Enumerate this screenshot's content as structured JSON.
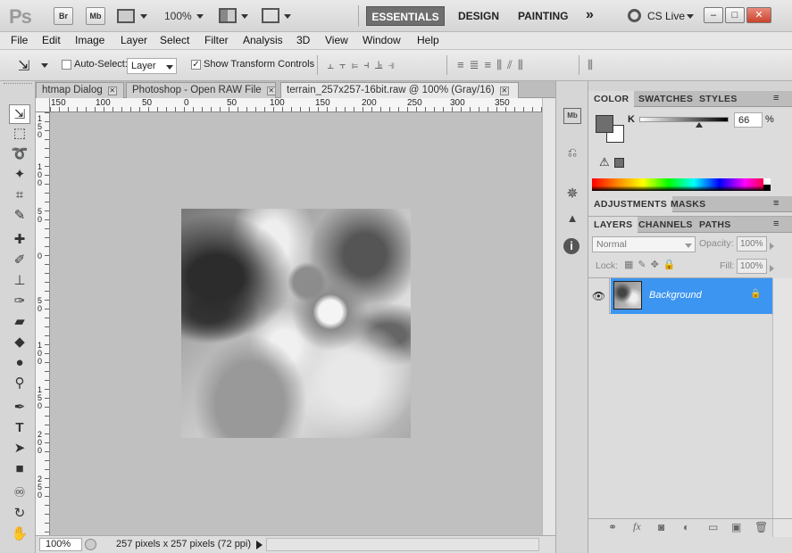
{
  "app": {
    "logo": "Ps",
    "bridge_label": "Br",
    "minibridge_label": "Mb",
    "zoom": "100%",
    "workspaces": [
      "ESSENTIALS",
      "DESIGN",
      "PAINTING"
    ],
    "more": "»",
    "cslive": "CS Live"
  },
  "window_controls": {
    "minimize": "–",
    "restore": "□",
    "close": "✕"
  },
  "menu": [
    "File",
    "Edit",
    "Image",
    "Layer",
    "Select",
    "Filter",
    "Analysis",
    "3D",
    "View",
    "Window",
    "Help"
  ],
  "options": {
    "auto_select_label": "Auto-Select:",
    "auto_select_value": "Layer",
    "show_transform_label": "Show Transform Controls",
    "show_transform_checked": "✓"
  },
  "tabs": [
    {
      "label": "htmap Dialog"
    },
    {
      "label": "Photoshop - Open RAW File"
    },
    {
      "label": "terrain_257x257-16bit.raw @ 100% (Gray/16)"
    }
  ],
  "ruler_h": [
    "150",
    "100",
    "50",
    "0",
    "50",
    "100",
    "150",
    "200",
    "250",
    "300",
    "350"
  ],
  "ruler_v": [
    "1",
    "5",
    "0",
    "1",
    "0",
    "0",
    "5",
    "0",
    "0",
    "5",
    "0",
    "1",
    "0",
    "0",
    "1",
    "5",
    "0",
    "2",
    "0",
    "0",
    "2",
    "5",
    "0"
  ],
  "status": {
    "zoom": "100%",
    "info": "257 pixels x 257 pixels (72 ppi)"
  },
  "color_panel": {
    "tabs": [
      "COLOR",
      "SWATCHES",
      "STYLES"
    ],
    "channel": "K",
    "value": "66",
    "unit": "%",
    "foreground": "#6e6e6e",
    "background": "#ffffff"
  },
  "adjust_panel": {
    "tabs": [
      "ADJUSTMENTS",
      "MASKS"
    ]
  },
  "layers_panel": {
    "tabs": [
      "LAYERS",
      "CHANNELS",
      "PATHS"
    ],
    "blend_mode": "Normal",
    "opacity_label": "Opacity:",
    "opacity": "100%",
    "lock_label": "Lock:",
    "fill_label": "Fill:",
    "fill": "100%",
    "layers": [
      {
        "name": "Background"
      }
    ]
  },
  "colors": {
    "accent": "#3c95f0"
  }
}
